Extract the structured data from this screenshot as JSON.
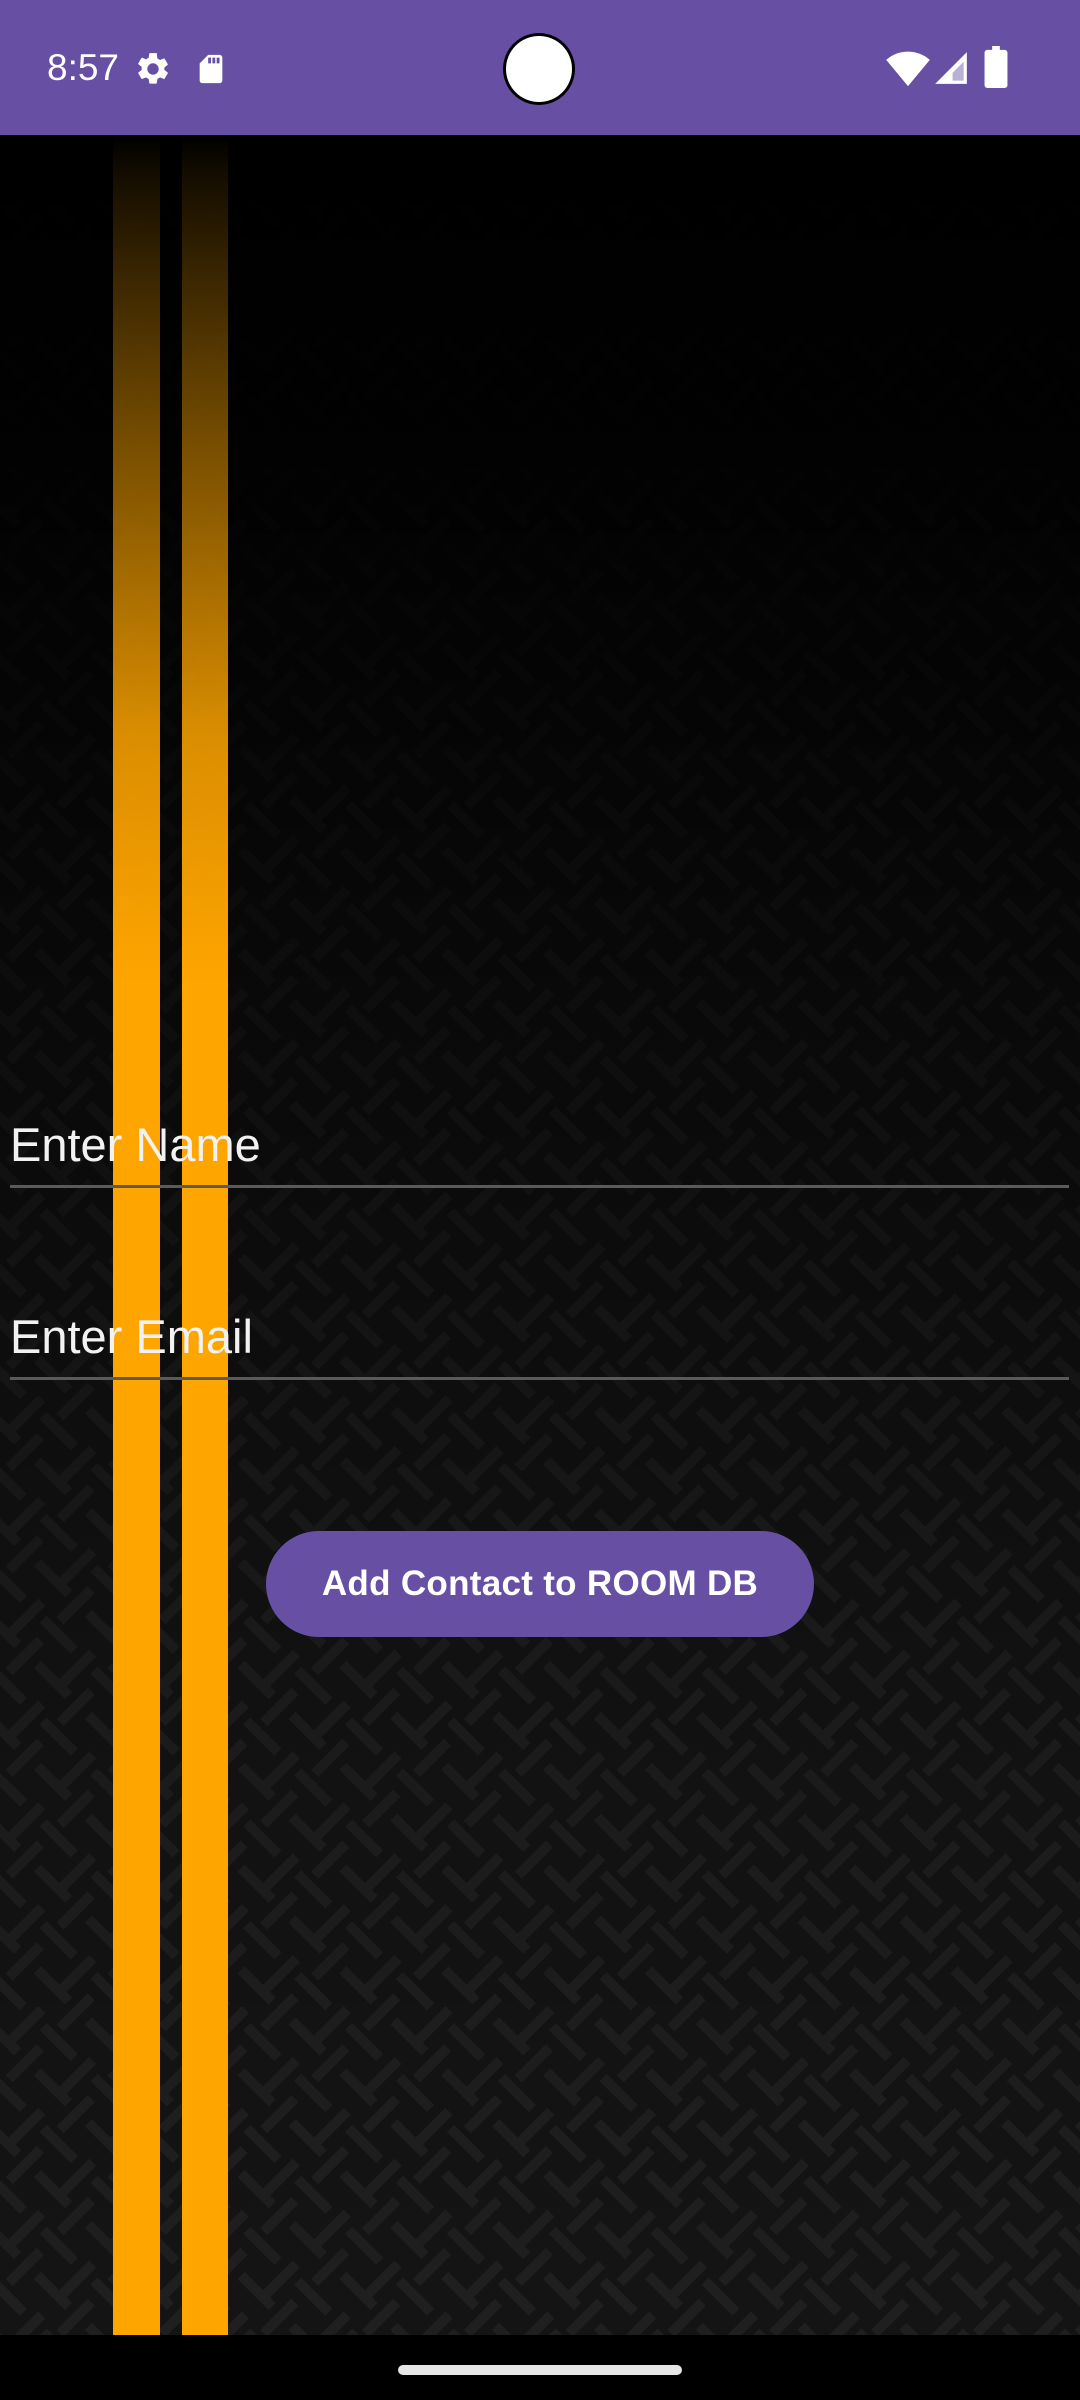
{
  "status_bar": {
    "time": "8:57",
    "left_icons": [
      "settings-icon",
      "sd-card-icon"
    ],
    "right_icons": [
      "wifi-icon",
      "cellular-signal-icon",
      "battery-icon"
    ],
    "background_color": "#6750a4"
  },
  "form": {
    "name_placeholder": "Enter Name",
    "email_placeholder": "Enter Email",
    "submit_label": "Add Contact to ROOM DB"
  },
  "colors": {
    "accent": "#6750a4",
    "stripe": "#ffa500",
    "background": "#000000"
  }
}
